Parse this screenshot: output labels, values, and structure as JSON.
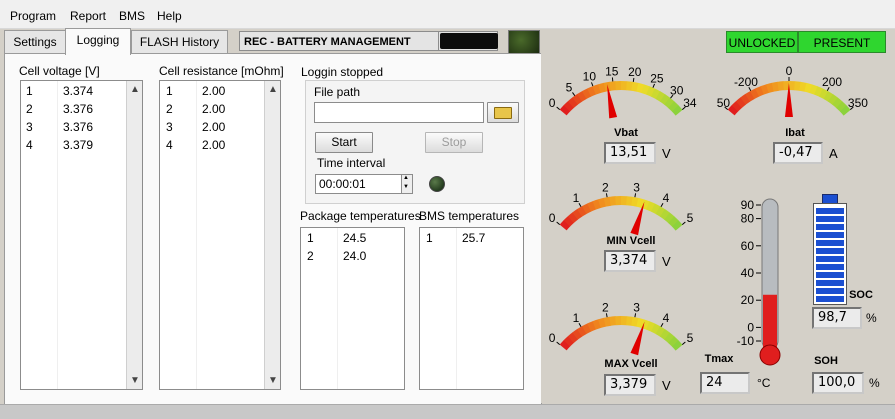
{
  "menu": [
    "Program",
    "Report",
    "BMS",
    "Help"
  ],
  "tabs": [
    "Settings",
    "Logging",
    "FLASH History"
  ],
  "header": {
    "title": "REC - BATTERY MANAGEMENT",
    "unlocked_label": "UNLOCKED",
    "present_label": "PRESENT"
  },
  "cell_voltage": {
    "label": "Cell voltage [V]",
    "rows": [
      {
        "index": "1",
        "value": "3.374"
      },
      {
        "index": "2",
        "value": "3.376"
      },
      {
        "index": "3",
        "value": "3.376"
      },
      {
        "index": "4",
        "value": "3.379"
      }
    ]
  },
  "cell_resistance": {
    "label": "Cell resistance [mOhm]",
    "rows": [
      {
        "index": "1",
        "value": "2.00"
      },
      {
        "index": "2",
        "value": "2.00"
      },
      {
        "index": "3",
        "value": "2.00"
      },
      {
        "index": "4",
        "value": "2.00"
      }
    ]
  },
  "logging": {
    "status": "Loggin stopped",
    "file_path_label": "File path",
    "file_path_value": "",
    "start_label": "Start",
    "stop_label": "Stop",
    "interval_label": "Time interval",
    "interval_value": "00:00:01"
  },
  "package_temps": {
    "label": "Package temperatures",
    "rows": [
      {
        "index": "1",
        "value": "24.5"
      },
      {
        "index": "2",
        "value": "24.0"
      }
    ]
  },
  "bms_temps": {
    "label": "BMS temperatures",
    "rows": [
      {
        "index": "1",
        "value": "25.7"
      }
    ]
  },
  "gauges": {
    "vbat": {
      "title": "Vbat",
      "value": "13,51",
      "unit": "V",
      "min": 0,
      "max": 34,
      "needle": 13.51,
      "ticks": [
        "0",
        "5",
        "10",
        "15",
        "20",
        "25",
        "30",
        "34"
      ]
    },
    "ibat": {
      "title": "Ibat",
      "value": "-0,47",
      "unit": "A",
      "min": -350,
      "max": 350,
      "needle": -0.47,
      "ticks": [
        "350",
        "-200",
        "0",
        "200",
        "350"
      ]
    },
    "min_vcell": {
      "title": "MIN Vcell",
      "value": "3,374",
      "unit": "V",
      "min": 0,
      "max": 5,
      "needle": 3.374,
      "ticks": [
        "0",
        "1",
        "2",
        "3",
        "4",
        "5"
      ]
    },
    "max_vcell": {
      "title": "MAX Vcell",
      "value": "3,379",
      "unit": "V",
      "min": 0,
      "max": 5,
      "needle": 3.379,
      "ticks": [
        "0",
        "1",
        "2",
        "3",
        "4",
        "5"
      ]
    }
  },
  "tmax": {
    "title": "Tmax",
    "value": "24",
    "unit": "°C",
    "level": 24,
    "min": -10,
    "max": 90,
    "ticks": [
      "90",
      "80",
      "60",
      "40",
      "20",
      "0",
      "-10"
    ]
  },
  "soc": {
    "title": "SOC",
    "value": "98,7",
    "unit": "%",
    "level_percent": 98.7
  },
  "soh": {
    "title": "SOH",
    "value": "100,0",
    "unit": "%"
  },
  "colors": {
    "status_green": "#2fd62f",
    "thermo_red": "#e01e1e",
    "battery_blue": "#1b4fd1",
    "needle_red": "#e00000"
  }
}
